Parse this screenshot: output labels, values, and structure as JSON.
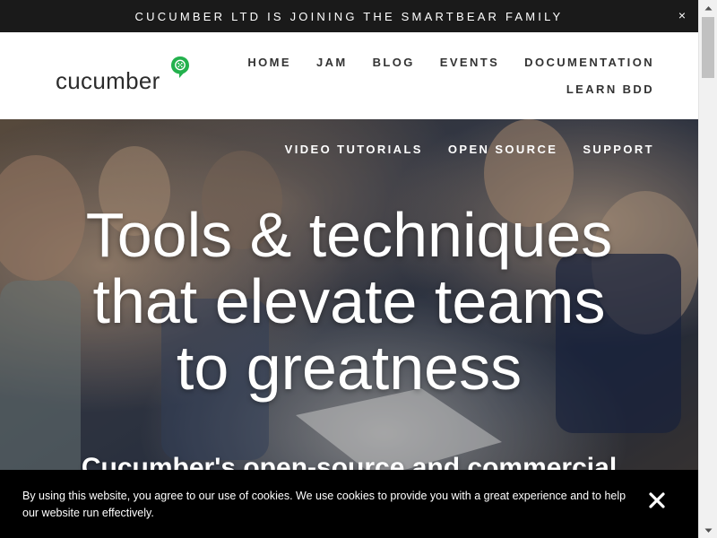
{
  "announcement": {
    "text": "CUCUMBER LTD IS JOINING THE SMARTBEAR FAMILY",
    "close_label": "×"
  },
  "header": {
    "logo_text": "cucumber",
    "logo_icon": "cucumber-icon",
    "nav_primary": [
      {
        "label": "HOME"
      },
      {
        "label": "JAM"
      },
      {
        "label": "BLOG"
      },
      {
        "label": "EVENTS"
      },
      {
        "label": "DOCUMENTATION"
      }
    ],
    "nav_secondary": [
      {
        "label": "LEARN BDD"
      }
    ]
  },
  "hero": {
    "subnav": [
      {
        "label": "VIDEO TUTORIALS"
      },
      {
        "label": "OPEN SOURCE"
      },
      {
        "label": "SUPPORT"
      }
    ],
    "title_lines": [
      "Tools & techniques",
      "that elevate teams",
      "to greatness"
    ],
    "subtitle": "Cucumber's open-source and commercial"
  },
  "cookie_banner": {
    "text": "By using this website, you agree to our use of cookies. We use cookies to provide you with a great experience and to help our website run effectively.",
    "close_icon": "close-icon"
  },
  "colors": {
    "announcement_bg": "#1a1a1a",
    "brand_green": "#23b14d",
    "nav_text": "#333333",
    "cookie_bg": "#000000"
  }
}
